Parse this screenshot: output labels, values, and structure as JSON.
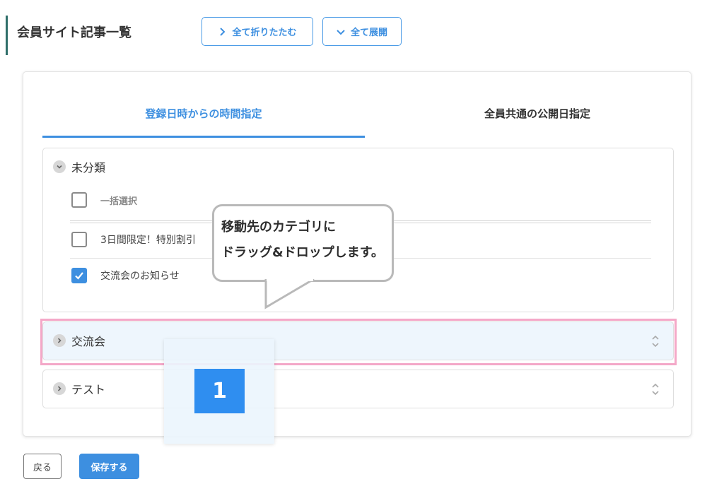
{
  "header": {
    "title": "会員サイト記事一覧",
    "collapse_all_label": "全て折りたたむ",
    "expand_all_label": "全て展開"
  },
  "tabs": [
    {
      "label": "登録日時からの時間指定",
      "active": true
    },
    {
      "label": "全員共通の公開日指定",
      "active": false
    }
  ],
  "categories": [
    {
      "name": "未分類",
      "expanded": true,
      "select_all_label": "一括選択",
      "items": [
        {
          "label": "3日間限定！特別割引",
          "checked": false
        },
        {
          "label": "交流会のお知らせ",
          "checked": true
        }
      ]
    },
    {
      "name": "交流会",
      "expanded": false
    },
    {
      "name": "テスト",
      "expanded": false
    }
  ],
  "callout": {
    "line1": "移動先のカテゴリに",
    "line2": "ドラッグ&ドロップします。"
  },
  "step_badge": "1",
  "footer": {
    "back_label": "戻る",
    "save_label": "保存する"
  },
  "colors": {
    "accent": "#3d8fe0",
    "highlight_border": "#f4a8c8",
    "title_bar": "#2f6f6a",
    "badge": "#2f8ef0"
  }
}
